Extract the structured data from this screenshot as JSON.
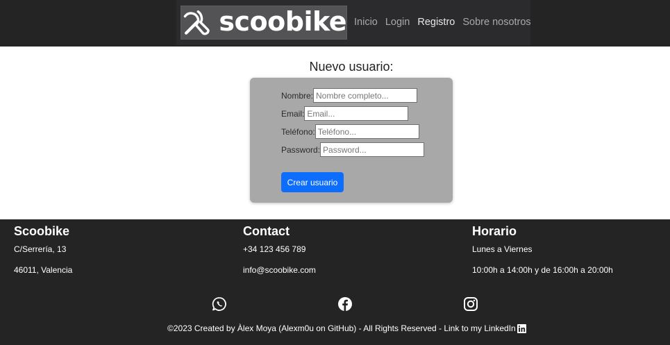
{
  "header": {
    "logo_text": "scoobike",
    "nav": [
      {
        "label": "Inicio",
        "active": false
      },
      {
        "label": "Login",
        "active": false
      },
      {
        "label": "Registro",
        "active": true
      },
      {
        "label": "Sobre nosotros",
        "active": false
      }
    ]
  },
  "form": {
    "title": "Nuevo usuario:",
    "fields": [
      {
        "label": "Nombre:",
        "placeholder": "Nombre completo..."
      },
      {
        "label": "Email:",
        "placeholder": "Email..."
      },
      {
        "label": "Teléfono:",
        "placeholder": "Teléfono..."
      },
      {
        "label": "Password:",
        "placeholder": "Password..."
      }
    ],
    "submit_label": "Crear usuario"
  },
  "footer": {
    "columns": [
      {
        "title": "Scoobike",
        "line1": "C/Serrería, 13",
        "line2": "46011, Valencia"
      },
      {
        "title": "Contact",
        "line1": "+34 123 456 789",
        "line2": "info@scoobike.com"
      },
      {
        "title": "Horario",
        "line1": "Lunes a Viernes",
        "line2": "10:00h a 14:00h y de 16:00h a 20:00h"
      }
    ],
    "social_icons": [
      "whatsapp-icon",
      "facebook-icon",
      "instagram-icon"
    ],
    "copyright": "©2023 Created by Àlex Moya (Alexm0u on GitHub) - All Rights Reserved - Link to my LinkedIn"
  },
  "colors": {
    "header_bg": "#252425",
    "card_bg": "#a8a8a8",
    "button": "#0d6efd"
  }
}
